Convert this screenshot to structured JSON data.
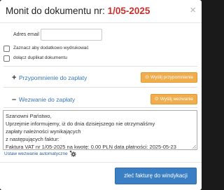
{
  "modal": {
    "title_prefix": "Monit do dokumentu nr:",
    "title_number": "1/05-2025",
    "close_glyph": "×"
  },
  "email": {
    "label": "Adres email",
    "value": "",
    "placeholder": ""
  },
  "options": [
    {
      "label": "Zaznacz aby dodatkowo wydrukować",
      "checked": false
    },
    {
      "label": "dołącz duplikat dokumentu",
      "checked": false
    }
  ],
  "sections": {
    "reminder": {
      "toggle": "+",
      "title": "Przypomnienie do zapłaty",
      "button": "Wyślij przypomnienie",
      "button_icon": "send-circle-icon"
    },
    "demand": {
      "toggle": "–",
      "title": "Wezwanie do zapłaty",
      "button": "Wyślij wezwanie",
      "button_icon": "send-circle-icon"
    }
  },
  "message": {
    "text": "Szanowni Państwo,\nUprzejmie informujemy, iż do dnia dzisiejszego nie otrzymaliśmy\nzapłaty należności wynikających\nz następujących faktur:\nFaktura VAT nr 1/05-2025 na kwotę: 0.00 PLN data płatności: 2025-05-23"
  },
  "auto": {
    "link": "Ustaw wezwanie automatyczne",
    "icon": "gear-icon"
  },
  "footer": {
    "button": "zleć fakturę do windykacji"
  },
  "colors": {
    "accent_blue": "#3a7fc4",
    "accent_orange": "#f0ad4e",
    "number_red": "#c9302c",
    "section_title_blue": "#3a78b8"
  }
}
